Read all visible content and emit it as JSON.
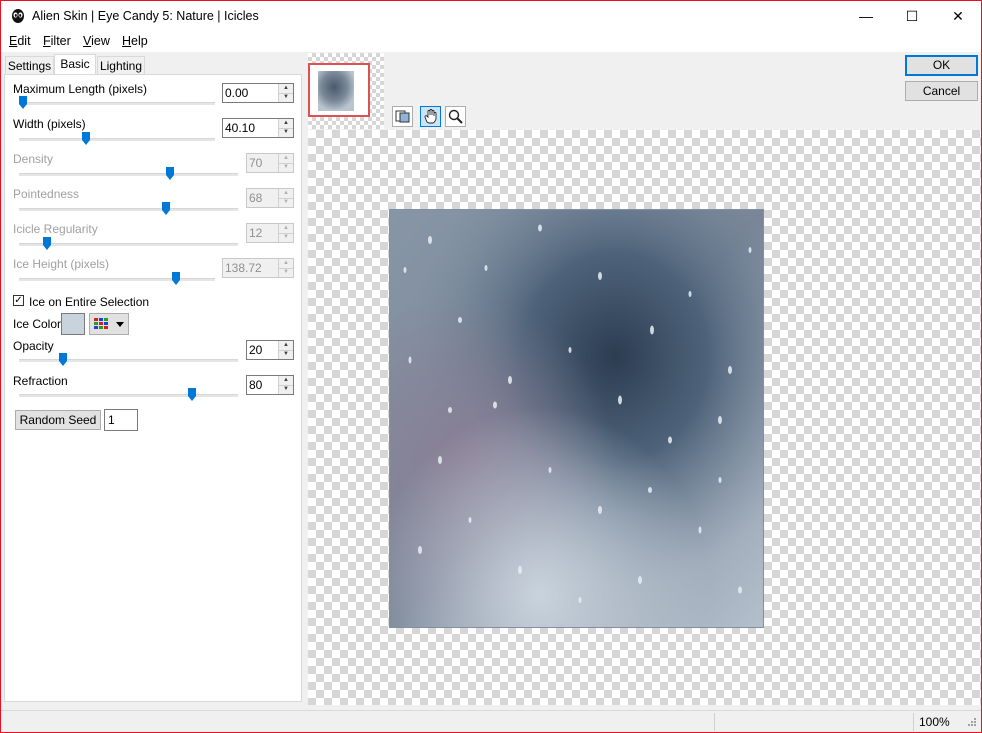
{
  "window": {
    "title": "Alien Skin | Eye Candy 5: Nature | Icicles",
    "minimize_glyph": "—",
    "maximize_glyph": "☐",
    "close_glyph": "✕"
  },
  "menu": {
    "edit_hot": "E",
    "edit_rest": "dit",
    "filter_hot": "F",
    "filter_rest": "ilter",
    "view_hot": "V",
    "view_rest": "iew",
    "help_hot": "H",
    "help_rest": "elp"
  },
  "tabs": {
    "settings": "Settings",
    "basic": "Basic",
    "lighting": "Lighting"
  },
  "controls": {
    "max_length": {
      "label": "Maximum Length (pixels)",
      "value": "0.00",
      "fraction": 0.02
    },
    "width": {
      "label": "Width (pixels)",
      "value": "40.10",
      "fraction": 0.34
    },
    "density": {
      "label": "Density",
      "value": "70",
      "fraction": 0.69
    },
    "pointedness": {
      "label": "Pointedness",
      "value": "68",
      "fraction": 0.67
    },
    "icicle_regularity": {
      "label": "Icicle Regularity",
      "value": "12",
      "fraction": 0.13
    },
    "ice_height": {
      "label": "Ice Height (pixels)",
      "value": "138.72",
      "fraction": 0.8
    },
    "ice_on_entire_selection": {
      "label": "Ice on Entire Selection",
      "checked": true,
      "check_glyph": "✓"
    },
    "ice_color": {
      "label": "Ice Color",
      "swatch": "#c8d3dd"
    },
    "opacity": {
      "label": "Opacity",
      "value": "20",
      "fraction": 0.2
    },
    "refraction": {
      "label": "Refraction",
      "value": "80",
      "fraction": 0.79
    },
    "random_seed": {
      "label": "Random Seed",
      "value": "1"
    }
  },
  "buttons": {
    "ok": "OK",
    "cancel": "Cancel"
  },
  "tools": [
    "preview-toggle-icon",
    "hand-icon",
    "zoom-icon"
  ],
  "status": {
    "zoom": "100%"
  },
  "colors": {
    "accent": "#0078d7",
    "thumb": "#0078d7",
    "nav_frame": "#e05050",
    "window_border": "#e81123"
  }
}
